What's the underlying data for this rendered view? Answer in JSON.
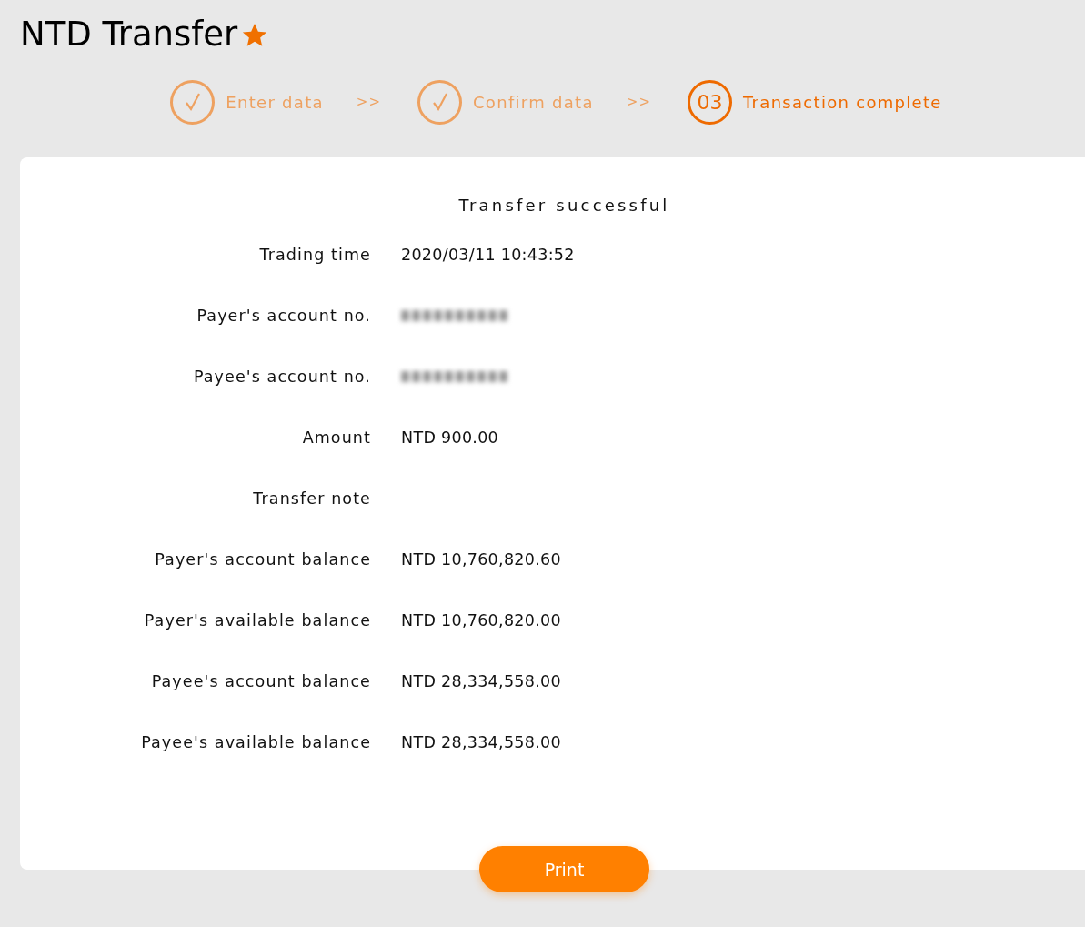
{
  "page": {
    "title": "NTD Transfer",
    "favorite": true
  },
  "steps": [
    {
      "label": "Enter data",
      "completed": true,
      "selected": false
    },
    {
      "label": "Confirm data",
      "completed": true,
      "selected": false
    },
    {
      "number": "03",
      "label": "Transaction complete",
      "completed": false,
      "selected": true
    }
  ],
  "step_separators": [
    ">>",
    ">>"
  ],
  "result": {
    "heading": "Transfer successful",
    "rows": [
      {
        "kind": "text",
        "label": "Trading time",
        "value": "2020/03/11 10:43:52"
      },
      {
        "kind": "blurred",
        "label": "Payer's account no."
      },
      {
        "kind": "blurred",
        "label": "Payee's account no."
      },
      {
        "kind": "text",
        "label": "Amount",
        "value": "NTD 900.00"
      },
      {
        "kind": "empty",
        "label": "Transfer note"
      },
      {
        "kind": "text",
        "label": "Payer's account balance",
        "value": "NTD 10,760,820.60"
      },
      {
        "kind": "text",
        "label": "Payer's available balance",
        "value": "NTD 10,760,820.00"
      },
      {
        "kind": "text",
        "label": "Payee's account balance",
        "value": "NTD 28,334,558.00"
      },
      {
        "kind": "text",
        "label": "Payee's available balance",
        "value": "NTD 28,334,558.00"
      }
    ]
  },
  "buttons": [
    {
      "label": "Print"
    }
  ]
}
